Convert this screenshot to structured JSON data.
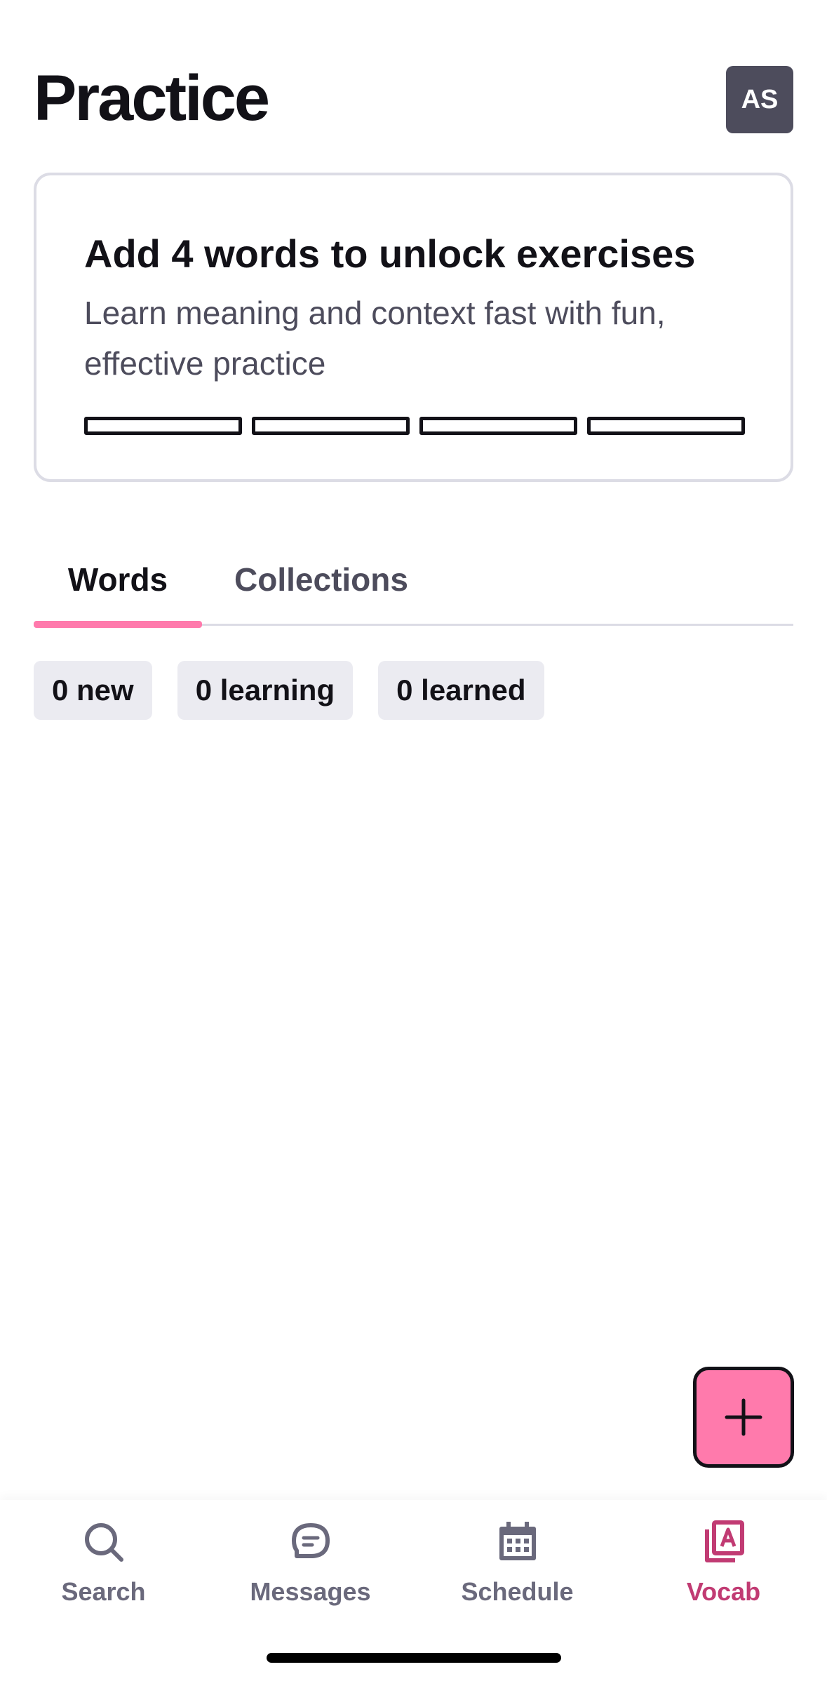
{
  "header": {
    "title": "Practice",
    "avatar_initials": "AS"
  },
  "unlock_card": {
    "title": "Add 4 words to unlock exercises",
    "description": "Learn meaning and context fast with fun, effective practice",
    "progress_segments_total": 4,
    "progress_segments_filled": 0
  },
  "tabs": [
    {
      "label": "Words",
      "active": true
    },
    {
      "label": "Collections",
      "active": false
    }
  ],
  "chips": [
    {
      "label": "0 new"
    },
    {
      "label": "0 learning"
    },
    {
      "label": "0 learned"
    }
  ],
  "fab": {
    "icon": "plus-icon"
  },
  "bottom_nav": [
    {
      "label": "Search",
      "icon": "search-icon",
      "active": false
    },
    {
      "label": "Messages",
      "icon": "messages-icon",
      "active": false
    },
    {
      "label": "Schedule",
      "icon": "calendar-icon",
      "active": false
    },
    {
      "label": "Vocab",
      "icon": "vocab-icon",
      "active": true
    }
  ],
  "colors": {
    "accent": "#ff7aac",
    "accent_text": "#c13b73",
    "text_primary": "#121117",
    "text_secondary": "#4d4c5c",
    "chip_bg": "#ebebf1",
    "avatar_bg": "#4d4c5c"
  }
}
